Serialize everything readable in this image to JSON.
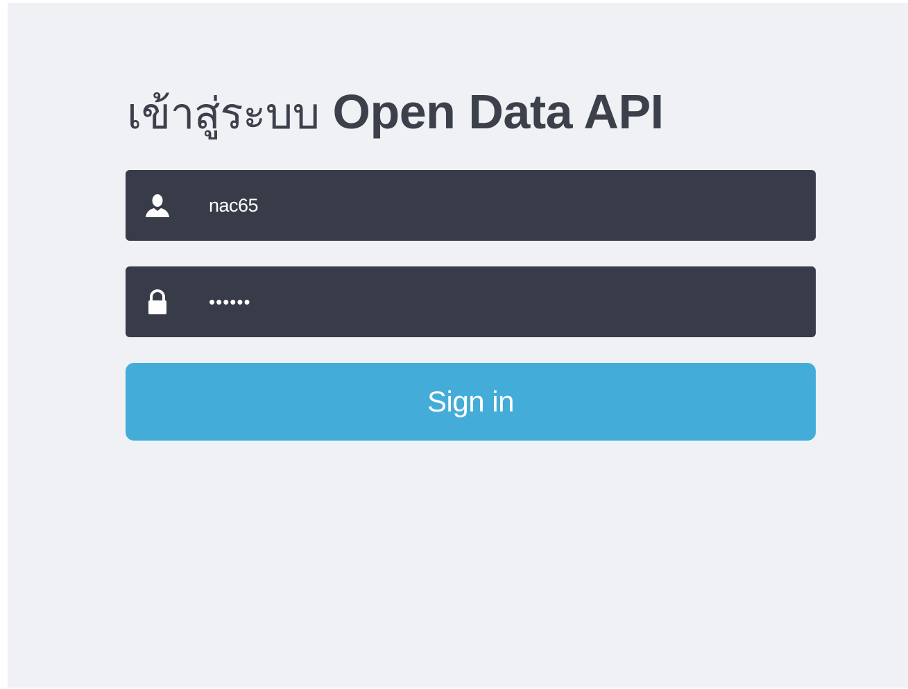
{
  "login": {
    "title_thai": "เข้าสู่ระบบ",
    "title_brand": "Open Data API",
    "username": {
      "icon": "user-icon",
      "value": "nac65"
    },
    "password": {
      "icon": "lock-icon",
      "value": "••••••"
    },
    "signin_label": "Sign in"
  },
  "colors": {
    "background": "#f0f1f5",
    "field_background": "#383c48",
    "button_background": "#44acd8",
    "title_text": "#3b404b",
    "field_text": "#ffffff"
  }
}
